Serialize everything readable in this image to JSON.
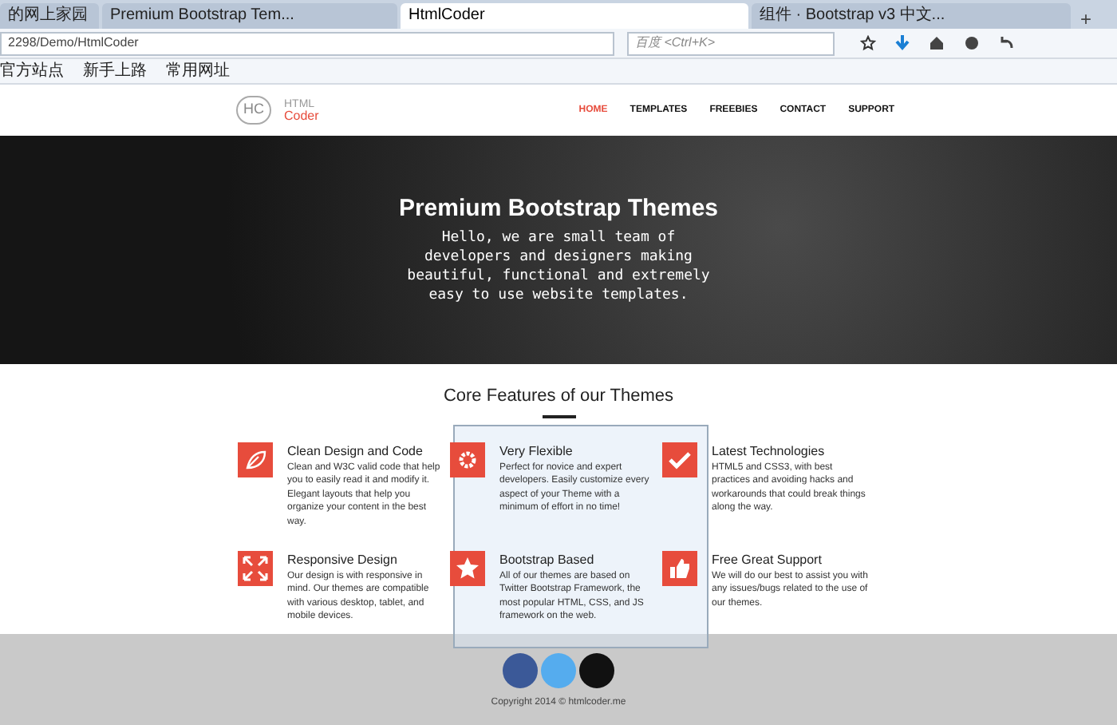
{
  "browser": {
    "tabs": [
      {
        "label": "的网上家园",
        "selected": false
      },
      {
        "label": "Premium Bootstrap Tem...",
        "selected": false
      },
      {
        "label": "HtmlCoder",
        "selected": true
      },
      {
        "label": "组件 · Bootstrap v3 中文...",
        "selected": false
      }
    ],
    "new_tab": "+",
    "address": "2298/Demo/HtmlCoder",
    "search_placeholder": "百度 <Ctrl+K>",
    "bookmarks": [
      "官方站点",
      "新手上路",
      "常用网址"
    ]
  },
  "site": {
    "logo_mark": "HC",
    "logo_top": "HTML",
    "logo_bottom": "Coder",
    "nav": [
      {
        "label": "HOME",
        "selected": true
      },
      {
        "label": "TEMPLATES",
        "selected": false
      },
      {
        "label": "FREEBIES",
        "selected": false
      },
      {
        "label": "CONTACT",
        "selected": false
      },
      {
        "label": "SUPPORT",
        "selected": false
      }
    ],
    "hero": {
      "title": "Premium Bootstrap Themes",
      "text": "Hello, we are small team of developers and designers making beautiful, functional and extremely easy to use website templates."
    },
    "features_title": "Core Features of our Themes",
    "features": [
      {
        "kind": "leaf",
        "title": "Clean Design and Code",
        "text": "Clean and W3C valid code that help you to easily read it and modify it. Elegant layouts that help you organize your content in the best way."
      },
      {
        "kind": "gear",
        "title": "Very Flexible",
        "text": "Perfect for novice and expert developers. Easily customize every aspect of your Theme with a minimum of effort in no time!"
      },
      {
        "kind": "check",
        "title": "Latest Technologies",
        "text": "HTML5 and CSS3, with best practices and avoiding hacks and workarounds that could break things along the way."
      },
      {
        "kind": "expand",
        "title": "Responsive Design",
        "text": "Our design is with responsive in mind. Our themes are compatible with various desktop, tablet, and mobile devices."
      },
      {
        "kind": "star",
        "title": "Bootstrap Based",
        "text": "All of our themes are based on Twitter Bootstrap Framework, the most popular HTML, CSS, and JS framework on the web."
      },
      {
        "kind": "thumb",
        "title": "Free Great Support",
        "text": "We will do our best to assist you with any issues/bugs related to the use of our themes."
      }
    ],
    "social": [
      {
        "color": "#3b5998"
      },
      {
        "color": "#55acee"
      },
      {
        "color": "#111111"
      }
    ],
    "copyright": "Copyright 2014 © htmlcoder.me"
  }
}
